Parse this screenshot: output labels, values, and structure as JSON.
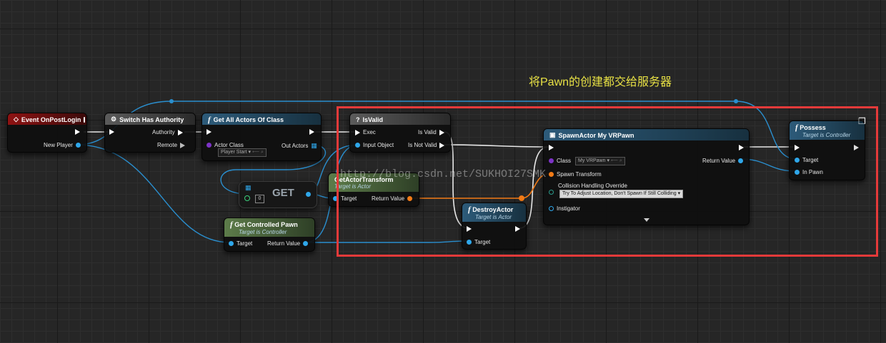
{
  "caption": "将Pawn的创建都交给服务器",
  "watermark": "http://blog.csdn.net/SUKHOI27SMK",
  "nodes": {
    "event_post_login": {
      "title": "Event OnPostLogin",
      "pins": {
        "new_player": "New Player"
      }
    },
    "switch_authority": {
      "title": "Switch Has Authority",
      "pins": {
        "authority": "Authority",
        "remote": "Remote"
      }
    },
    "get_all_actors": {
      "title": "Get All Actors Of Class",
      "pins": {
        "actor_class": "Actor Class",
        "actor_class_value": "Player Start",
        "out_actors": "Out Actors"
      }
    },
    "is_valid": {
      "title": "IsValid",
      "pins": {
        "exec": "Exec",
        "input_object": "Input Object",
        "is_valid": "Is Valid",
        "is_not_valid": "Is Not Valid"
      }
    },
    "get_array": {
      "title": "GET",
      "index": "0"
    },
    "get_actor_transform": {
      "title": "GetActorTransform",
      "subtitle": "Target is Actor",
      "pins": {
        "target": "Target",
        "return_value": "Return Value"
      }
    },
    "get_controlled_pawn": {
      "title": "Get Controlled Pawn",
      "subtitle": "Target is Controller",
      "pins": {
        "target": "Target",
        "return_value": "Return Value"
      }
    },
    "destroy_actor": {
      "title": "DestroyActor",
      "subtitle": "Target is Actor",
      "pins": {
        "target": "Target"
      }
    },
    "spawn_actor": {
      "title": "SpawnActor My VRPawn",
      "pins": {
        "class": "Class",
        "class_value": "My VRPawn",
        "spawn_transform": "Spawn Transform",
        "collision": "Collision Handling Override",
        "collision_value": "Try To Adjust Location, Don't Spawn If Still Colliding",
        "instigator": "Instigator",
        "return_value": "Return Value"
      }
    },
    "possess": {
      "title": "Possess",
      "subtitle": "Target is Controller",
      "pins": {
        "target": "Target",
        "in_pawn": "In Pawn"
      }
    }
  },
  "colors": {
    "event_header": "#8e1212",
    "function_header": "#2d5b7a",
    "pure_header": "#5d7c4a",
    "object_pin": "#2fa7ea",
    "struct_pin": "#f37b16",
    "class_pin": "#7d33c7",
    "selection": "#e53a3a",
    "caption": "#e7e044"
  },
  "icons": {
    "event": "event-diamond-icon",
    "switch": "switch-icon",
    "function": "function-f-icon",
    "question": "question-icon",
    "array": "array-grid-icon",
    "delete": "delete-cube-icon"
  }
}
